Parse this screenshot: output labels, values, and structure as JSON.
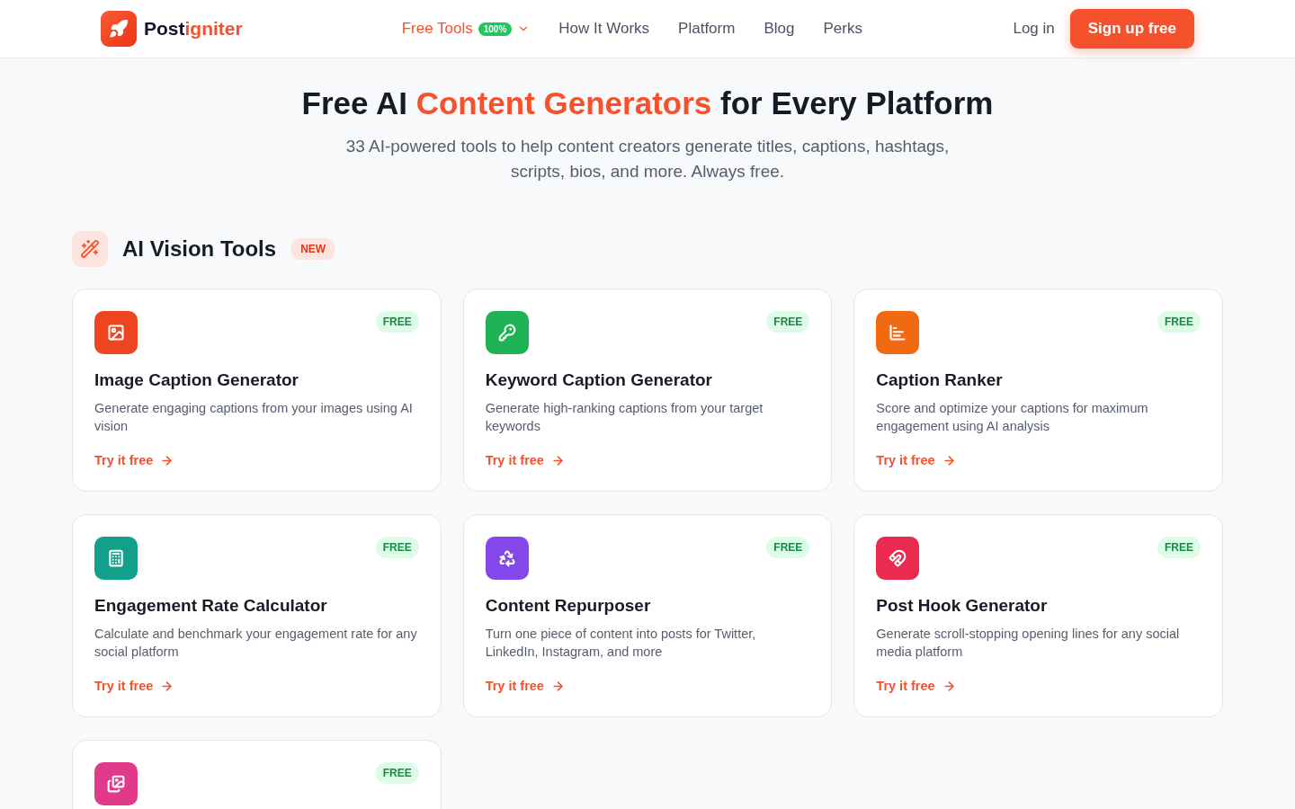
{
  "header": {
    "logo": [
      {
        "text": "Post",
        "accent": false
      },
      {
        "text": "igniter",
        "accent": true
      }
    ],
    "nav": [
      {
        "label": "Free Tools",
        "selected": true,
        "badge": "100%",
        "dropdown": true
      },
      {
        "label": "How It Works",
        "selected": false
      },
      {
        "label": "Platform",
        "selected": false
      },
      {
        "label": "Blog",
        "selected": false
      },
      {
        "label": "Perks",
        "selected": false
      }
    ],
    "login": "Log in",
    "signup": "Sign up free"
  },
  "hero": {
    "title": [
      {
        "text": "Free AI ",
        "accent": false
      },
      {
        "text": "Content Generators",
        "accent": true
      },
      {
        "text": " for Every Platform",
        "accent": false
      }
    ],
    "subtitle": "33 AI-powered tools to help content creators generate titles, captions, hashtags, scripts, bios, and more. Always free."
  },
  "section": {
    "title": "AI Vision Tools",
    "badge": "NEW",
    "tools": [
      {
        "kind": "image",
        "color": "#ef4420",
        "badge": "FREE",
        "title": "Image Caption Generator",
        "description": "Generate engaging captions from your images using AI vision",
        "link": "Try it free"
      },
      {
        "kind": "key",
        "color": "#1fb356",
        "badge": "FREE",
        "title": "Keyword Caption Generator",
        "description": "Generate high-ranking captions from your target keywords",
        "link": "Try it free"
      },
      {
        "kind": "chart",
        "color": "#f06a12",
        "badge": "FREE",
        "title": "Caption Ranker",
        "description": "Score and optimize your captions for maximum engagement using AI analysis",
        "link": "Try it free"
      },
      {
        "kind": "calculator",
        "color": "#12a08c",
        "badge": "FREE",
        "title": "Engagement Rate Calculator",
        "description": "Calculate and benchmark your engagement rate for any social platform",
        "link": "Try it free"
      },
      {
        "kind": "recycle",
        "color": "#8447ea",
        "badge": "FREE",
        "title": "Content Repurposer",
        "description": "Turn one piece of content into posts for Twitter, LinkedIn, Instagram, and more",
        "link": "Try it free"
      },
      {
        "kind": "magnet",
        "color": "#ea2a4e",
        "badge": "FREE",
        "title": "Post Hook Generator",
        "description": "Generate scroll-stopping opening lines for any social media platform",
        "link": "Try it free"
      },
      {
        "kind": "images",
        "color": "#e23a8a",
        "badge": "FREE"
      }
    ]
  }
}
